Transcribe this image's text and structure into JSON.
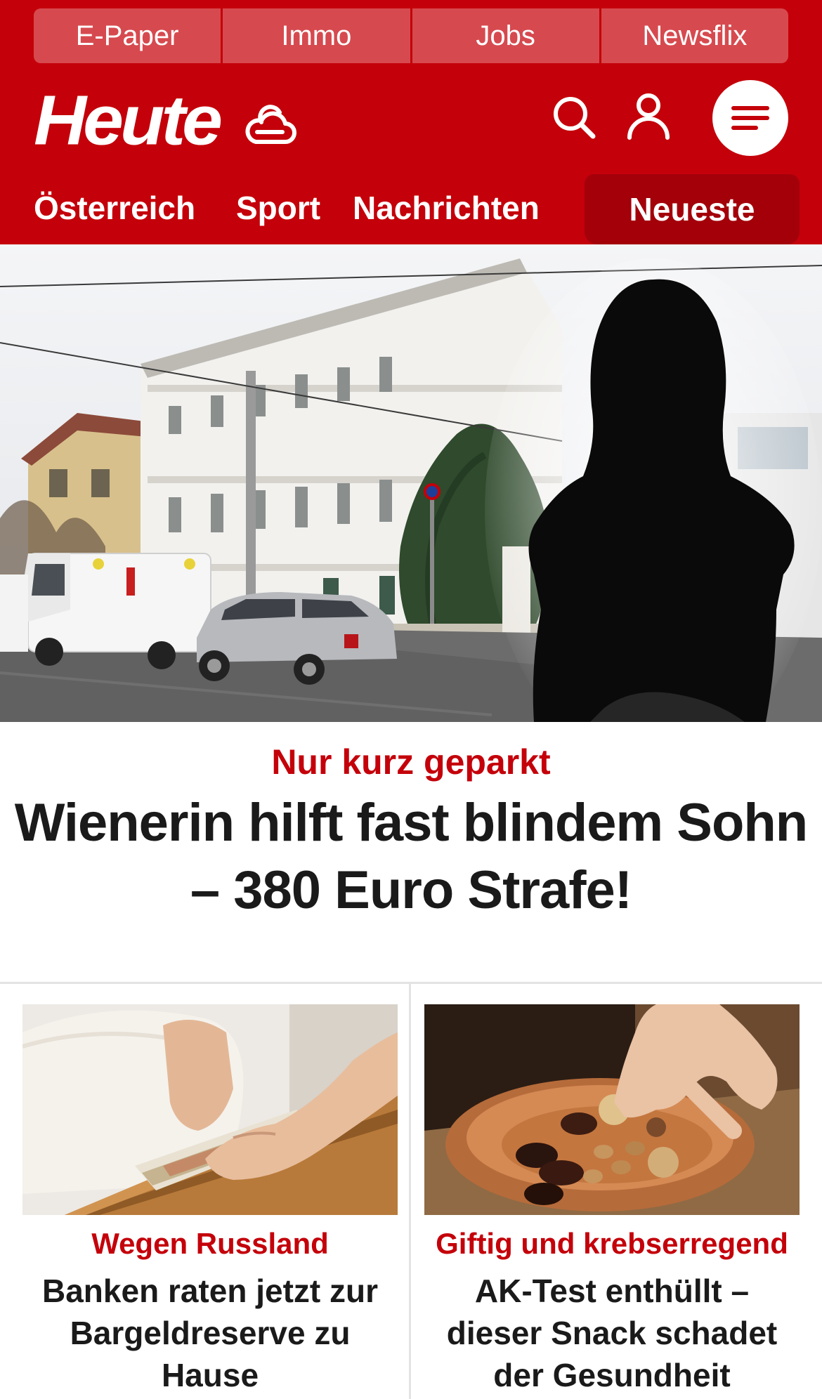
{
  "top_links": [
    "E-Paper",
    "Immo",
    "Jobs",
    "Newsflix"
  ],
  "brand": {
    "logo_text": "Heute"
  },
  "nav": {
    "items": [
      "Österreich",
      "Sport",
      "Nachrichten"
    ],
    "active": "Neueste"
  },
  "icons": {
    "weather": "weather-cloud-icon",
    "search": "search-icon",
    "account": "user-icon",
    "menu": "hamburger-menu-icon"
  },
  "colors": {
    "brand_red": "#c4000a",
    "top_link_bg": "#d64a4f",
    "active_tab_bg": "#a3000a",
    "headline_text": "#1a1a1a"
  },
  "hero": {
    "kicker": "Nur kurz geparkt",
    "title": "Wienerin hilft fast blindem Sohn – 380 Euro Strafe!"
  },
  "cards": [
    {
      "kicker": "Wegen Russland",
      "title": "Banken raten jetzt zur Bargeldreserve zu Hause"
    },
    {
      "kicker": "Giftig und krebserregend",
      "title": "AK-Test enthüllt – dieser Snack schadet der Gesundheit"
    }
  ]
}
